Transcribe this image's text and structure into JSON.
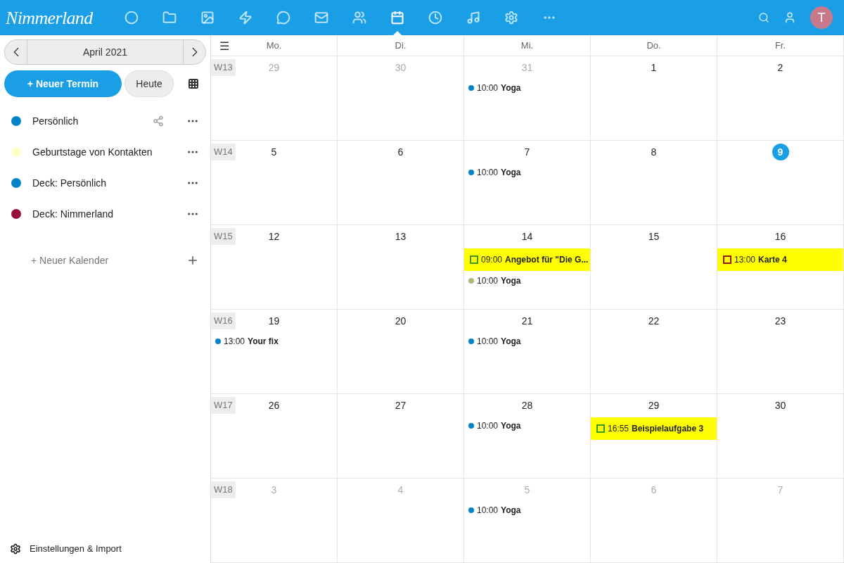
{
  "app_bar": {
    "logo": "Nimmerland",
    "nav": [
      {
        "kind": "dashboard",
        "selected": false
      },
      {
        "kind": "files",
        "selected": false
      },
      {
        "kind": "photos",
        "selected": false
      },
      {
        "kind": "activity",
        "selected": false
      },
      {
        "kind": "talk",
        "selected": false
      },
      {
        "kind": "mail",
        "selected": false
      },
      {
        "kind": "contacts",
        "selected": false
      },
      {
        "kind": "calendar",
        "selected": true
      },
      {
        "kind": "clock",
        "selected": false
      },
      {
        "kind": "music",
        "selected": false
      },
      {
        "kind": "settings",
        "selected": false
      },
      {
        "kind": "more",
        "selected": false
      }
    ],
    "avatar": "T"
  },
  "sidebar": {
    "month": "April 2021",
    "new_event": "+ Neuer Termin",
    "today": "Heute",
    "calendars": [
      {
        "name": "Persönlich",
        "color": "#0082c9",
        "shared": true
      },
      {
        "name": "Geburtstage von Kontakten",
        "color": "#ffffc8",
        "shared": false
      },
      {
        "name": "Deck: Persönlich",
        "color": "#0082c9",
        "shared": false
      },
      {
        "name": "Deck: Nimmerland",
        "color": "#9a0c3c",
        "shared": false
      }
    ],
    "new_calendar": "+ Neuer Kalender",
    "settings": "Einstellungen & Import"
  },
  "calendar": {
    "menu": "☰",
    "days": [
      "Mo.",
      "Di.",
      "Mi.",
      "Do.",
      "Fr."
    ],
    "weeks": [
      {
        "label": "W13",
        "cells": [
          {
            "day": "29",
            "muted": true,
            "today": false
          },
          {
            "day": "30",
            "muted": true,
            "today": false
          },
          {
            "day": "31",
            "muted": true,
            "today": false,
            "events": [
              {
                "kind": "dot",
                "time": "10:00",
                "title": "Yoga",
                "color": "#0082c9"
              }
            ]
          },
          {
            "day": "1",
            "muted": false,
            "today": false
          },
          {
            "day": "2",
            "muted": false,
            "today": false
          }
        ]
      },
      {
        "label": "W14",
        "cells": [
          {
            "day": "5",
            "muted": false,
            "today": false
          },
          {
            "day": "6",
            "muted": false,
            "today": false
          },
          {
            "day": "7",
            "muted": false,
            "today": false,
            "events": [
              {
                "kind": "dot",
                "time": "10:00",
                "title": "Yoga",
                "color": "#0082c9"
              }
            ]
          },
          {
            "day": "8",
            "muted": false,
            "today": false
          },
          {
            "day": "9",
            "muted": false,
            "today": true
          }
        ]
      },
      {
        "label": "W15",
        "cells": [
          {
            "day": "12",
            "muted": false,
            "today": false
          },
          {
            "day": "13",
            "muted": false,
            "today": false
          },
          {
            "day": "14",
            "muted": false,
            "today": false,
            "events": [
              {
                "kind": "task",
                "time": "09:00",
                "title": "Angebot für \"Die G...",
                "color": "#3a9a1a"
              },
              {
                "kind": "dot",
                "time": "10:00",
                "title": "Yoga",
                "color": "#b5b57a"
              }
            ]
          },
          {
            "day": "15",
            "muted": false,
            "today": false
          },
          {
            "day": "16",
            "muted": false,
            "today": false,
            "events": [
              {
                "kind": "task",
                "time": "13:00",
                "title": "Karte 4",
                "color": "#9a1a1a"
              }
            ]
          }
        ]
      },
      {
        "label": "W16",
        "cells": [
          {
            "day": "19",
            "muted": false,
            "today": false,
            "events": [
              {
                "kind": "dot",
                "time": "13:00",
                "title": "Your fix",
                "color": "#0082c9"
              }
            ]
          },
          {
            "day": "20",
            "muted": false,
            "today": false
          },
          {
            "day": "21",
            "muted": false,
            "today": false,
            "events": [
              {
                "kind": "dot",
                "time": "10:00",
                "title": "Yoga",
                "color": "#0082c9"
              }
            ]
          },
          {
            "day": "22",
            "muted": false,
            "today": false
          },
          {
            "day": "23",
            "muted": false,
            "today": false
          }
        ]
      },
      {
        "label": "W17",
        "cells": [
          {
            "day": "26",
            "muted": false,
            "today": false
          },
          {
            "day": "27",
            "muted": false,
            "today": false
          },
          {
            "day": "28",
            "muted": false,
            "today": false,
            "events": [
              {
                "kind": "dot",
                "time": "10:00",
                "title": "Yoga",
                "color": "#0082c9"
              }
            ]
          },
          {
            "day": "29",
            "muted": false,
            "today": false,
            "events": [
              {
                "kind": "task",
                "time": "16:55",
                "title": "Beispielaufgabe 3",
                "color": "#3a9a1a"
              }
            ]
          },
          {
            "day": "30",
            "muted": false,
            "today": false
          }
        ]
      },
      {
        "label": "W18",
        "cells": [
          {
            "day": "3",
            "muted": true,
            "today": false
          },
          {
            "day": "4",
            "muted": true,
            "today": false
          },
          {
            "day": "5",
            "muted": true,
            "today": false,
            "events": [
              {
                "kind": "dot",
                "time": "10:00",
                "title": "Yoga",
                "color": "#0082c9"
              }
            ]
          },
          {
            "day": "6",
            "muted": true,
            "today": false
          },
          {
            "day": "7",
            "muted": true,
            "today": false
          }
        ]
      }
    ]
  }
}
